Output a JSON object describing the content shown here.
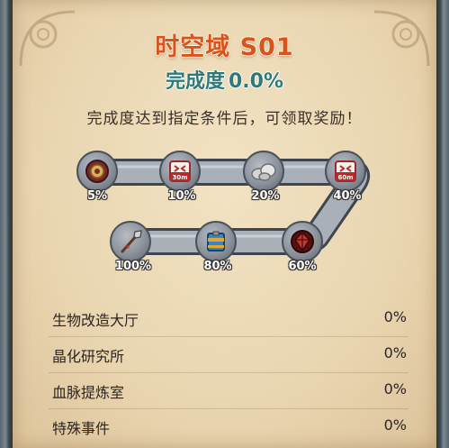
{
  "title": "时空域 S01",
  "completion": {
    "label": "完成度",
    "value": "0.0%"
  },
  "hint": "完成度达到指定条件后，可领取奖励！",
  "milestones": [
    {
      "percent": "5%",
      "icon": "gold-medal-icon"
    },
    {
      "percent": "10%",
      "icon": "speedup-30m-icon",
      "badge": "30m"
    },
    {
      "percent": "20%",
      "icon": "ore-rocks-icon"
    },
    {
      "percent": "40%",
      "icon": "speedup-60m-icon",
      "badge": "60m"
    },
    {
      "percent": "60%",
      "icon": "red-crystal-icon"
    },
    {
      "percent": "80%",
      "icon": "supply-crate-icon"
    },
    {
      "percent": "100%",
      "icon": "spear-icon"
    }
  ],
  "rows": [
    {
      "name": "生物改造大厅",
      "value": "0%"
    },
    {
      "name": "晶化研究所",
      "value": "0%"
    },
    {
      "name": "血脉提炼室",
      "value": "0%"
    },
    {
      "name": "特殊事件",
      "value": "0%"
    }
  ]
}
